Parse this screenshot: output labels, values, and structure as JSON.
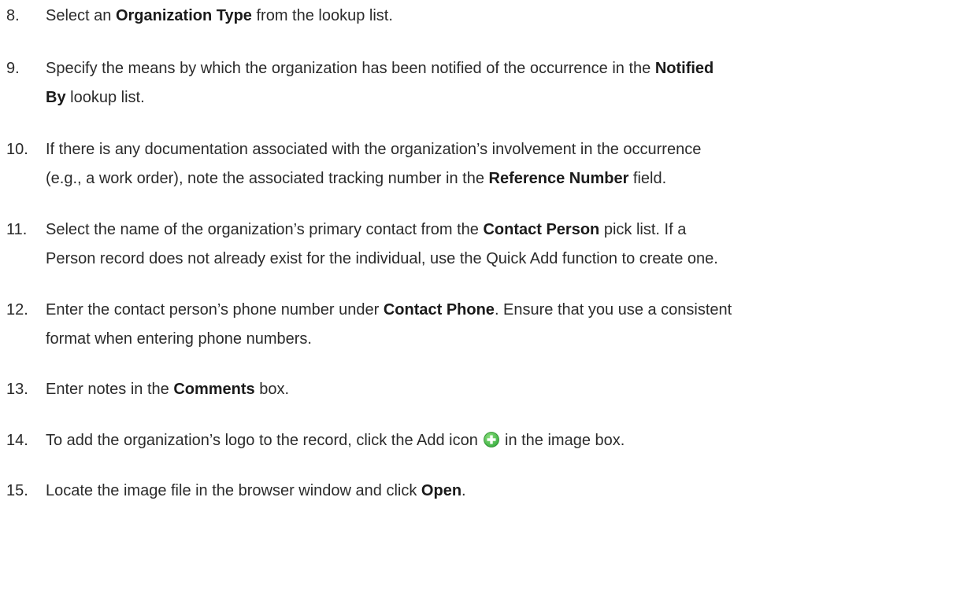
{
  "steps": [
    {
      "number": "8.",
      "lines": [
        [
          {
            "t": "Select an "
          },
          {
            "t": "Organization Type",
            "b": true
          },
          {
            "t": " from the lookup list."
          }
        ]
      ]
    },
    {
      "number": "9.",
      "lines": [
        [
          {
            "t": "Specify the means by which the organization has been notified of the occurrence in the "
          },
          {
            "t": "Notified",
            "b": true
          }
        ],
        [
          {
            "t": "By",
            "b": true
          },
          {
            "t": " lookup list."
          }
        ]
      ]
    },
    {
      "number": "10.",
      "lines": [
        [
          {
            "t": "If there is any documentation associated with the organization’s involvement in the occurrence"
          }
        ],
        [
          {
            "t": "(e.g., a work order), note the associated tracking number in the "
          },
          {
            "t": "Reference Number",
            "b": true
          },
          {
            "t": " field."
          }
        ]
      ]
    },
    {
      "number": "11.",
      "lines": [
        [
          {
            "t": "Select the name of the organization’s primary contact from the "
          },
          {
            "t": "Contact Person",
            "b": true
          },
          {
            "t": " pick list. If a"
          }
        ],
        [
          {
            "t": "Person record does not already exist for the individual, use the Quick Add function to create one."
          }
        ]
      ]
    },
    {
      "number": "12.",
      "lines": [
        [
          {
            "t": "Enter the contact person’s phone number under "
          },
          {
            "t": "Contact Phone",
            "b": true
          },
          {
            "t": ". Ensure that you use a consistent"
          }
        ],
        [
          {
            "t": "format when entering phone numbers."
          }
        ]
      ]
    },
    {
      "number": "13.",
      "lines": [
        [
          {
            "t": "Enter notes in the "
          },
          {
            "t": "Comments",
            "b": true
          },
          {
            "t": " box."
          }
        ]
      ]
    },
    {
      "number": "14.",
      "lines": [
        [
          {
            "t": "To add the organization’s logo to the record, click the Add icon "
          },
          {
            "icon": "add-icon"
          },
          {
            "t": " in the image box."
          }
        ]
      ]
    },
    {
      "number": "15.",
      "lines": [
        [
          {
            "t": "Locate the image file in the browser window and click "
          },
          {
            "t": "Open",
            "b": true
          },
          {
            "t": "."
          }
        ]
      ]
    }
  ],
  "colors": {
    "text": "#2b2b2b",
    "add_icon_green": "#3cb043"
  }
}
